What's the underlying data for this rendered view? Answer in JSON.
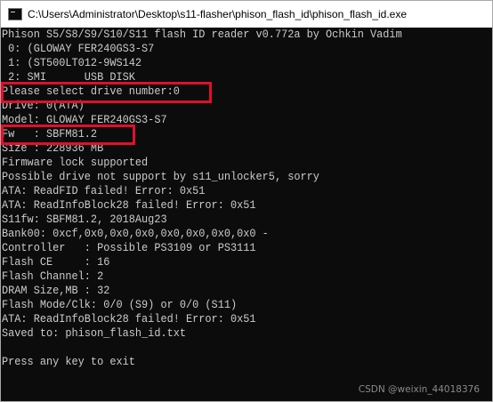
{
  "window": {
    "title": "C:\\Users\\Administrator\\Desktop\\s11-flasher\\phison_flash_id\\phison_flash_id.exe",
    "icon": "console-app-icon"
  },
  "console": {
    "lines": [
      "Phison S5/S8/S9/S10/S11 flash ID reader v0.772a by Ochkin Vadim",
      " 0: (GLOWAY FER240GS3-S7",
      " 1: (ST500LT012-9WS142",
      " 2: SMI      USB DISK",
      "Please select drive number:0",
      "Drive: 0(ATA)",
      "Model: GLOWAY FER240GS3-S7",
      "Fw   : SBFM81.2",
      "Size : 228936 MB",
      "Firmware lock supported",
      "Possible drive not support by s11_unlocker5, sorry",
      "ATA: ReadFID failed! Error: 0x51",
      "ATA: ReadInfoBlock28 failed! Error: 0x51",
      "S11fw: SBFM81.2, 2018Aug23",
      "Bank00: 0xcf,0x0,0x0,0x0,0x0,0x0,0x0,0x0 -",
      "Controller   : Possible PS3109 or PS3111",
      "Flash CE     : 16",
      "Flash Channel: 2",
      "DRAM Size,MB : 32",
      "Flash Mode/Clk: 0/0 (S9) or 0/0 (S11)",
      "ATA: ReadInfoBlock28 failed! Error: 0x51",
      "Saved to: phison_flash_id.txt",
      "",
      "Press any key to exit"
    ]
  },
  "annotations": {
    "highlight_color": "#e0102a"
  },
  "watermark": {
    "text": "CSDN @weixin_44018376"
  }
}
